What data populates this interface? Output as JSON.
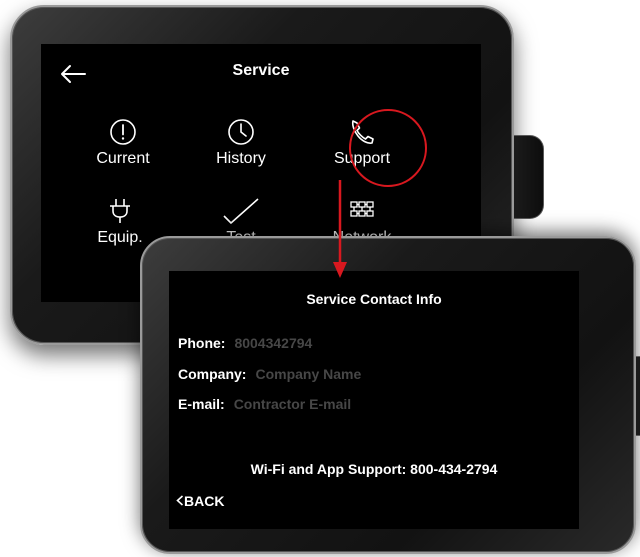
{
  "service_menu": {
    "title": "Service",
    "back_icon": "back-arrow-icon",
    "tiles": [
      {
        "label": "Current",
        "icon": "alert-circle-icon"
      },
      {
        "label": "History",
        "icon": "clock-icon"
      },
      {
        "label": "Support",
        "icon": "phone-icon"
      },
      {
        "label": "Equip.",
        "icon": "plug-icon"
      },
      {
        "label": "Test",
        "icon": "checkmark-icon"
      },
      {
        "label": "Network",
        "icon": "network-grid-icon"
      }
    ],
    "highlighted_tile": "Support",
    "highlight_color": "#d8181f"
  },
  "contact_info": {
    "title": "Service Contact Info",
    "phone_label": "Phone:",
    "phone_value": "8004342794",
    "company_label": "Company:",
    "company_placeholder": "Company Name",
    "email_label": "E-mail:",
    "email_placeholder": "Contractor E-mail",
    "support_line": "Wi-Fi and App Support: 800-434-2794",
    "back_label": "BACK",
    "back_icon": "chevron-left-icon"
  }
}
